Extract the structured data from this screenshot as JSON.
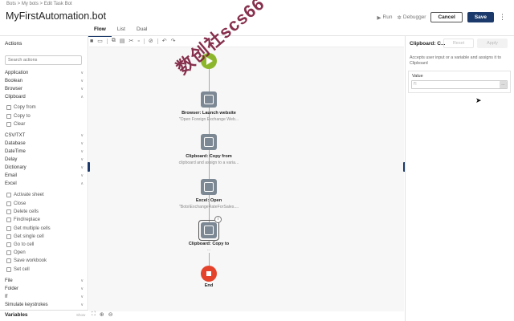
{
  "breadcrumb": "Bots  >  My bots  >  Edit Task Bot",
  "title": "MyFirstAutomation.bot",
  "topbar": {
    "run": "Run",
    "debugger": "Debugger",
    "cancel": "Cancel",
    "save": "Save"
  },
  "tabs": [
    {
      "label": "Flow"
    },
    {
      "label": "List"
    },
    {
      "label": "Dual"
    }
  ],
  "left": {
    "title": "Actions",
    "search_placeholder": "Search actions",
    "groups": [
      {
        "label": "Application"
      },
      {
        "label": "Boolean"
      },
      {
        "label": "Browser"
      },
      {
        "label": "Clipboard"
      },
      {
        "label": "CSV/TXT"
      },
      {
        "label": "Database"
      },
      {
        "label": "DateTime"
      },
      {
        "label": "Delay"
      },
      {
        "label": "Dictionary"
      },
      {
        "label": "Email"
      },
      {
        "label": "Excel"
      },
      {
        "label": "File"
      },
      {
        "label": "Folder"
      },
      {
        "label": "If"
      },
      {
        "label": "Simulate keystrokes"
      }
    ],
    "clipboard_items": [
      {
        "label": "Copy from"
      },
      {
        "label": "Copy to"
      },
      {
        "label": "Clear"
      }
    ],
    "excel_items": [
      {
        "label": "Activate sheet"
      },
      {
        "label": "Close"
      },
      {
        "label": "Delete cells"
      },
      {
        "label": "Find/replace"
      },
      {
        "label": "Get multiple cells"
      },
      {
        "label": "Get single cell"
      },
      {
        "label": "Go to cell"
      },
      {
        "label": "Open"
      },
      {
        "label": "Save workbook"
      },
      {
        "label": "Set cell"
      }
    ],
    "variables_label": "Variables",
    "variables_right": "Show"
  },
  "flow": {
    "nodes": [
      {
        "title": "Browser: Launch website",
        "sub": "\"Open Foreign Exchange Web..."
      },
      {
        "title": "Clipboard: Copy from",
        "sub": "clipboard and assign to a varia..."
      },
      {
        "title": "Excel: Open",
        "sub": "\"Bots\\ExchangeRateForSales...."
      },
      {
        "title": "Clipboard: Copy to",
        "sub": "..."
      }
    ],
    "end_label": "End",
    "info_badge": "i"
  },
  "watermark": "数创社scs66",
  "right": {
    "title": "Clipboard: C...",
    "reset": "Reset",
    "apply": "Apply",
    "desc": "Accepts user input or a variable and assigns it to Clipboard",
    "value_label": "Value",
    "value_placeholder": "f'l",
    "value_btn": "⋯"
  },
  "icons": {
    "run": "play-icon",
    "debugger": "bug-icon",
    "kebab": "more-icon"
  }
}
